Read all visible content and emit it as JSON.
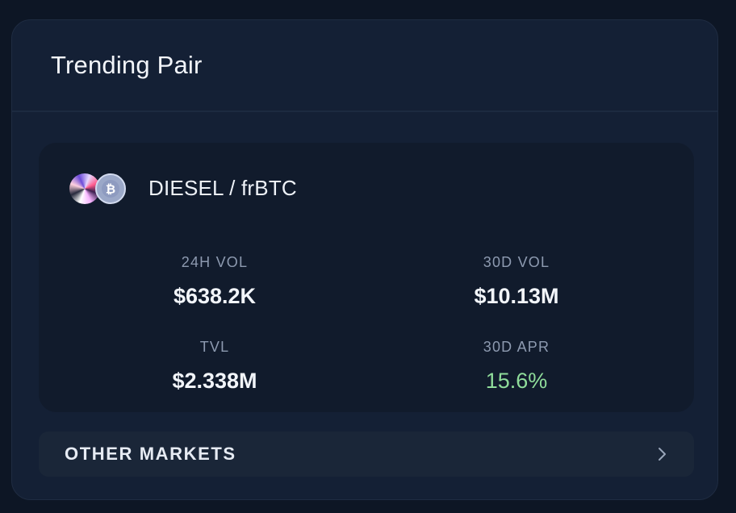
{
  "card": {
    "title": "Trending Pair"
  },
  "pair": {
    "name": "DIESEL / frBTC",
    "tokens": [
      {
        "symbol": "DIESEL",
        "icon": "diesel-token-icon"
      },
      {
        "symbol": "frBTC",
        "icon": "bitcoin-icon"
      }
    ],
    "stats": [
      {
        "label": "24H VOL",
        "value": "$638.2K"
      },
      {
        "label": "30D VOL",
        "value": "$10.13M"
      },
      {
        "label": "TVL",
        "value": "$2.338M"
      },
      {
        "label": "30D APR",
        "value": "15.6%"
      }
    ]
  },
  "other_markets": {
    "label": "OTHER MARKETS",
    "icon": "chevron-right-icon"
  },
  "colors": {
    "background": "#0d1625",
    "card": "#142035",
    "panel": "#111b2c",
    "positive": "#8fdc9a"
  }
}
